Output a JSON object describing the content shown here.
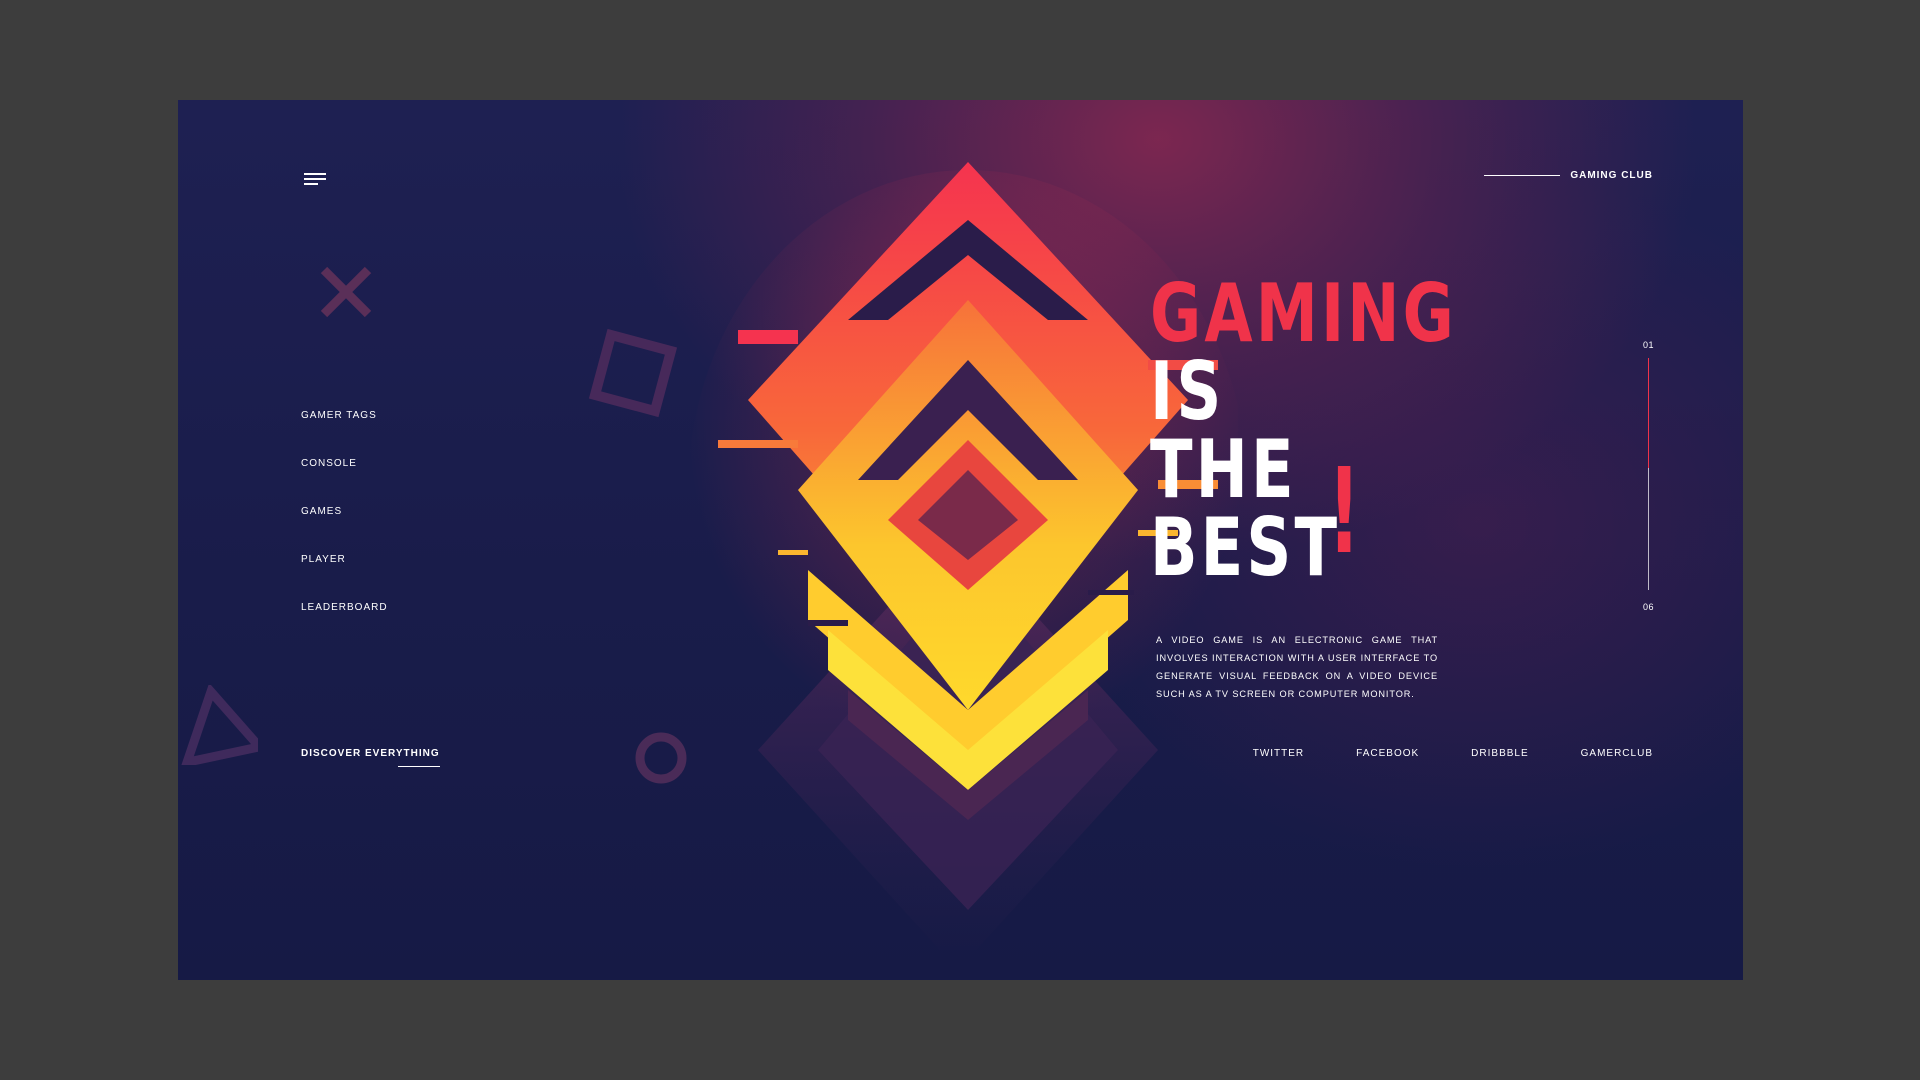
{
  "brand": {
    "label": "GAMING CLUB"
  },
  "nav": {
    "items": [
      {
        "label": "GAMER TAGS"
      },
      {
        "label": "CONSOLE"
      },
      {
        "label": "GAMES"
      },
      {
        "label": "PLAYER"
      },
      {
        "label": "LEADERBOARD"
      }
    ]
  },
  "hero": {
    "line1": "GAMING",
    "line2": "IS",
    "line3": "THE",
    "line4": "BEST",
    "exclaim": "!",
    "description": "A video game is an electronic game that involves interaction with a user interface to generate visual feedback on a video device such as a TV screen or computer monitor."
  },
  "slider": {
    "current": "01",
    "total": "06",
    "progress": 0.17
  },
  "footer": {
    "discover": "DISCOVER EVERYTHING",
    "social": [
      "TWITTER",
      "FACEBOOK",
      "DRIBBBLE",
      "GAMERCLUB"
    ]
  },
  "colors": {
    "accent": "#f0334a",
    "background": "#191c4a",
    "outer": "#3d3d3d"
  },
  "icons": [
    "menu-icon",
    "cross-icon",
    "square-icon",
    "triangle-icon",
    "circle-icon"
  ]
}
